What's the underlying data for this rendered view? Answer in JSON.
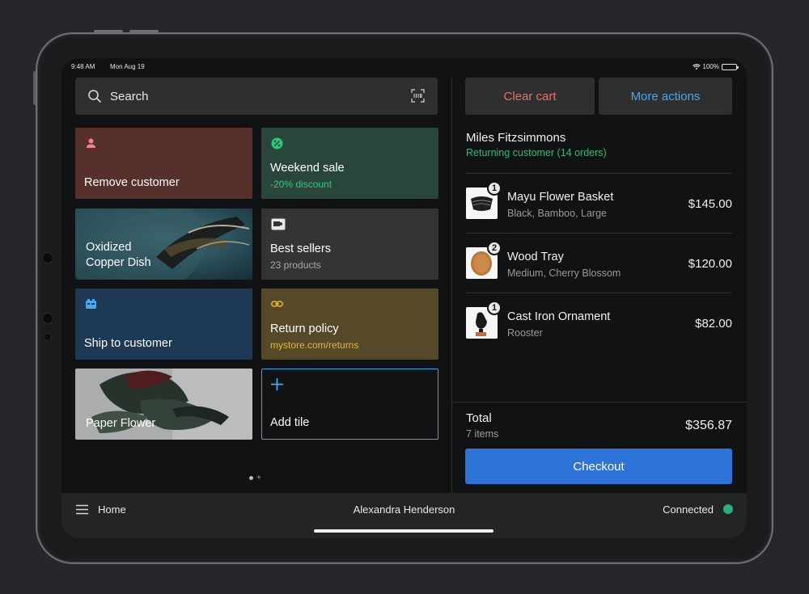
{
  "status_bar": {
    "time": "9:48 AM",
    "date": "Mon Aug 19",
    "battery": "100%"
  },
  "search": {
    "placeholder": "Search"
  },
  "tiles": {
    "remove_customer": {
      "title": "Remove customer",
      "icon": "person-icon",
      "color": "#56302a"
    },
    "weekend_sale": {
      "title": "Weekend sale",
      "subtitle": "-20% discount",
      "icon": "discount-icon",
      "color": "#28473a"
    },
    "oxidized": {
      "title_line1": "Oxidized",
      "title_line2": "Copper Dish"
    },
    "best_sellers": {
      "title": "Best sellers",
      "subtitle": "23 products",
      "icon": "product-icon"
    },
    "ship": {
      "title": "Ship to customer",
      "icon": "shipping-icon",
      "color": "#1d3954"
    },
    "return_policy": {
      "title": "Return policy",
      "subtitle": "mystore.com/returns",
      "icon": "link-icon",
      "color": "#56492a"
    },
    "paper_flower": {
      "title": "Paper Flower"
    },
    "add_tile": {
      "title": "Add tile",
      "icon": "plus-icon"
    }
  },
  "pager": {
    "add": "+"
  },
  "cart": {
    "clear_label": "Clear cart",
    "more_label": "More actions",
    "customer_name": "Miles Fitzsimmons",
    "customer_info": "Returning customer (14 orders)",
    "items": [
      {
        "qty": "1",
        "name": "Mayu Flower Basket",
        "variant": "Black, Bamboo, Large",
        "price": "$145.00"
      },
      {
        "qty": "2",
        "name": "Wood Tray",
        "variant": "Medium, Cherry Blossom",
        "price": "$120.00"
      },
      {
        "qty": "1",
        "name": "Cast Iron Ornament",
        "variant": "Rooster",
        "price": "$82.00"
      }
    ],
    "total_label": "Total",
    "total_count": "7 items",
    "total_amount": "$356.87",
    "checkout_label": "Checkout"
  },
  "bottom_bar": {
    "home_label": "Home",
    "user_name": "Alexandra Henderson",
    "connection": "Connected",
    "connection_color": "#2eae77"
  },
  "colors": {
    "accent": "#2e73d7",
    "danger": "#f06e62",
    "link": "#4aa8ee",
    "success": "#33b77b"
  }
}
